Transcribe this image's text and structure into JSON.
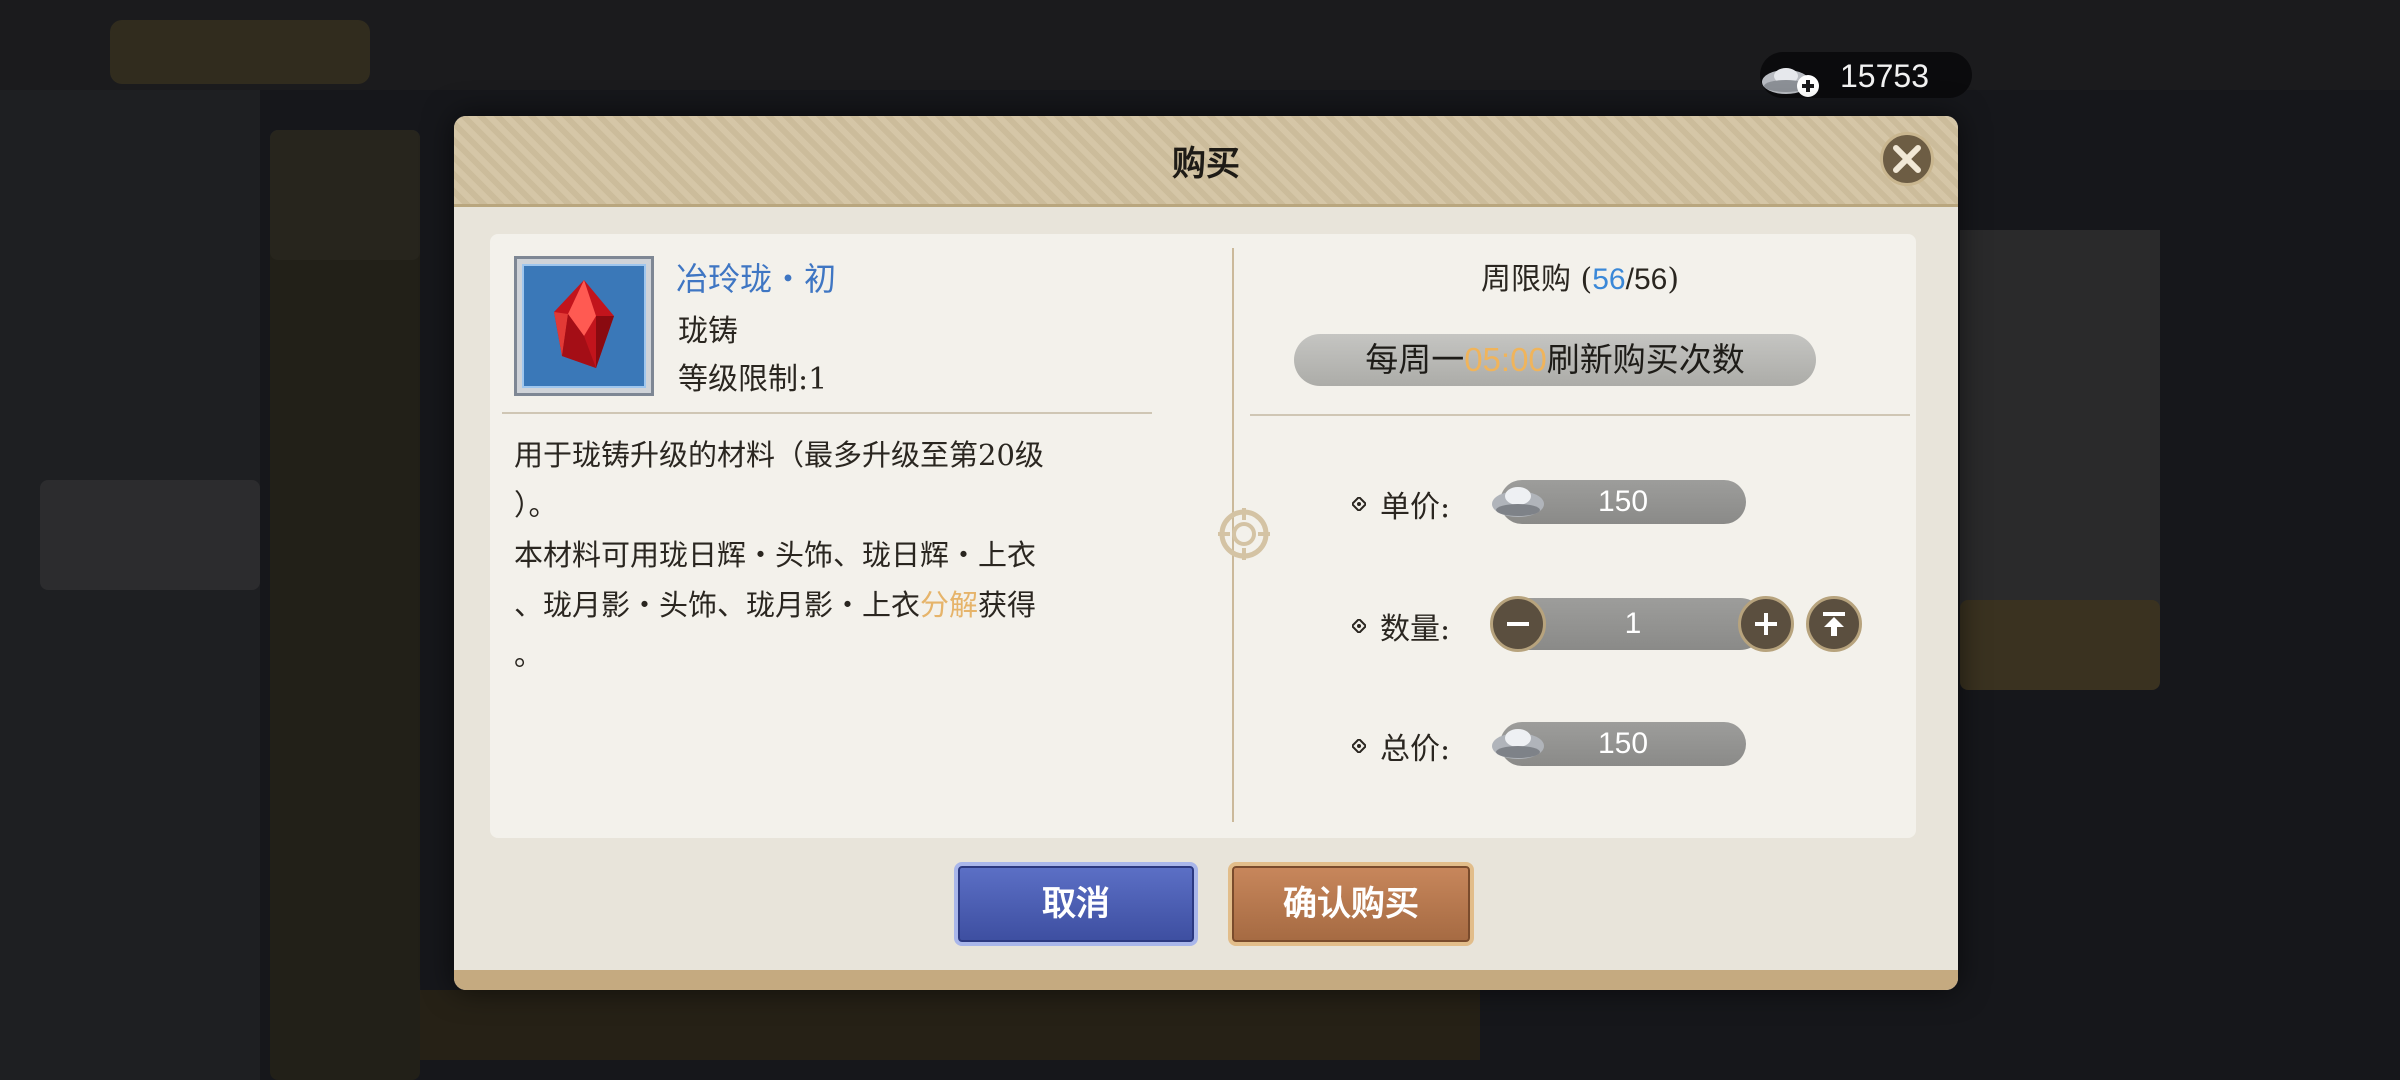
{
  "currency": {
    "amount": "15753",
    "icon": "silver-ingot-plus-icon"
  },
  "dialog": {
    "title": "购买",
    "item": {
      "name": "冶玲珑・初",
      "type": "珑铸",
      "level_limit": "等级限制:1",
      "icon": "red-crystal-icon"
    },
    "description": {
      "part1": "用于珑铸升级的材料（最多升级至第20级\n）。\n本材料可用珑日辉・头饰、珑日辉・上衣\n、珑月影・头饰、珑月影・上衣",
      "highlight": "分解",
      "part2": "获得\n。"
    },
    "weekly_limit": {
      "label": "周限购 (",
      "current": "56",
      "sep": "/",
      "total": "56",
      "close": ")"
    },
    "refresh": {
      "prefix": "每周一",
      "time": "05:00",
      "suffix": "刷新购买次数"
    },
    "unit_price": {
      "label": "单价:",
      "value": "150"
    },
    "quantity": {
      "label": "数量:",
      "value": "1"
    },
    "total_price": {
      "label": "总价:",
      "value": "150"
    },
    "buttons": {
      "cancel": "取消",
      "confirm": "确认购买"
    }
  },
  "colors": {
    "accent_blue": "#3a88d8",
    "highlight_gold": "#e6b46a",
    "cancel_blue": "#4a5cb0",
    "confirm_brown": "#b5784e"
  }
}
